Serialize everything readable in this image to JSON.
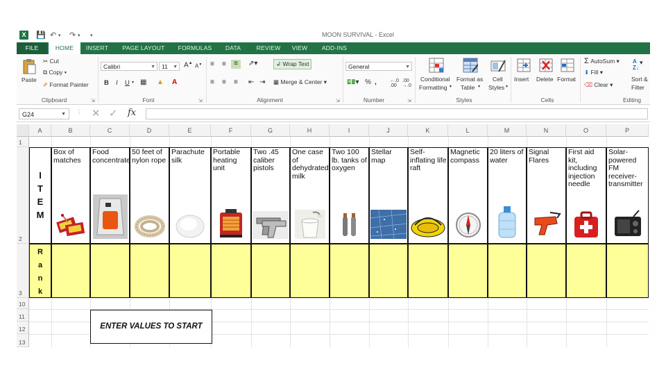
{
  "window_title": "MOON SURVIVAL - Excel",
  "tabs": [
    "FILE",
    "HOME",
    "INSERT",
    "PAGE LAYOUT",
    "FORMULAS",
    "DATA",
    "REVIEW",
    "VIEW",
    "ADD-INS"
  ],
  "ribbon": {
    "clipboard": {
      "paste": "Paste",
      "cut": "Cut",
      "copy": "Copy",
      "format_painter": "Format Painter",
      "group": "Clipboard"
    },
    "font": {
      "name": "Calibri",
      "size": "11",
      "group": "Font"
    },
    "alignment": {
      "wrap": "Wrap Text",
      "merge": "Merge & Center",
      "group": "Alignment"
    },
    "number": {
      "format": "General",
      "group": "Number"
    },
    "styles": {
      "cond1": "Conditional",
      "cond2": "Formatting",
      "table1": "Format as",
      "table2": "Table",
      "cell1": "Cell",
      "cell2": "Styles",
      "group": "Styles"
    },
    "cells": {
      "insert": "Insert",
      "delete": "Delete",
      "format": "Format",
      "group": "Cells"
    },
    "editing": {
      "autosum": "AutoSum",
      "fill": "Fill",
      "clear": "Clear",
      "sort1": "Sort &",
      "sort2": "Filter",
      "group": "Editing"
    }
  },
  "namebox": "G24",
  "fx": "fx",
  "columns": [
    "A",
    "B",
    "C",
    "D",
    "E",
    "F",
    "G",
    "H",
    "I",
    "J",
    "K",
    "L",
    "M",
    "N",
    "O",
    "P"
  ],
  "rows": [
    "1",
    "2",
    "3",
    "10",
    "11",
    "12",
    "13"
  ],
  "label_item": [
    "I",
    "T",
    "E",
    "M"
  ],
  "label_rank": [
    "R",
    "a",
    "n",
    "k"
  ],
  "items": [
    {
      "text": "Box of matches",
      "icon": "matches-icon"
    },
    {
      "text": "Food concentrate",
      "icon": "food-concentrate-icon"
    },
    {
      "text": "50 feet of nylon rope",
      "icon": "rope-icon"
    },
    {
      "text": "Parachute silk",
      "icon": "parachute-silk-icon"
    },
    {
      "text": "Portable heating unit",
      "icon": "heater-icon"
    },
    {
      "text": "Two .45 caliber pistols",
      "icon": "pistols-icon"
    },
    {
      "text": "One case of dehydrated milk",
      "icon": "milk-icon"
    },
    {
      "text": "Two 100 lb. tanks of oxygen",
      "icon": "oxygen-tanks-icon"
    },
    {
      "text": "Stellar map",
      "icon": "stellar-map-icon"
    },
    {
      "text": "Self-inflating life raft",
      "icon": "life-raft-icon"
    },
    {
      "text": "Magnetic compass",
      "icon": "compass-icon"
    },
    {
      "text": "20 liters of water",
      "icon": "water-jug-icon"
    },
    {
      "text": "Signal Flares",
      "icon": "flare-gun-icon"
    },
    {
      "text": "First aid kit, including injection needle",
      "icon": "first-aid-icon"
    },
    {
      "text": "Solar-powered FM receiver-transmitter",
      "icon": "radio-icon"
    }
  ],
  "enter_label": "ENTER VALUES TO START",
  "colors": {
    "excel_green": "#217346",
    "rank_fill": "#ffff99"
  }
}
